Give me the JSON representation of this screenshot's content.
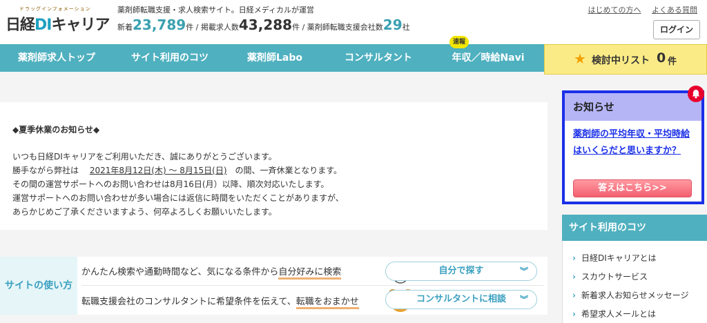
{
  "header": {
    "logo_small": "ドラッグインフォメーション",
    "logo_prefix": "日経",
    "logo_di": "DI",
    "logo_suffix": "キャリア",
    "tagline": "薬剤師転職支援・求人検索サイト。日経メディカルが運営",
    "stats": {
      "new_label": "新着",
      "new_count": "23,789",
      "unit1": "件 / 掲載求人数",
      "listed_count": "43,288",
      "unit2": "件 / 薬剤師転職支援会社数",
      "agencies_count": "29",
      "unit3": "社"
    },
    "links": [
      "はじめての方へ",
      "よくある質問"
    ],
    "login_label": "ログイン"
  },
  "nav": {
    "items": [
      "薬剤師求人トップ",
      "サイト利用のコツ",
      "薬剤師Labo",
      "コンサルタント",
      "年収／時給Navi"
    ],
    "badge": "速報",
    "watchlist_label": "検討中リスト",
    "watchlist_count": "0",
    "watchlist_unit": "件"
  },
  "notice": {
    "title": "◆夏季休業のお知らせ◆",
    "line1": "いつも日経DIキャリアをご利用いただき、誠にありがとうございます。",
    "line2_pre": "勝手ながら弊社は　 ",
    "line2_date": "2021年8月12日(木) ～ 8月15日(日)",
    "line2_post": "　の間、一斉休業となります。",
    "line3": "その間の運営サポートへのお問い合わせは8月16日(月）以降、順次対応いたします。",
    "line4": "運営サポートへのお問い合わせが多い場合には返信に時間をいただくことがありますが、",
    "line5": "あらかじめご了承くださいますよう、何卒よろしくお願いいたします。"
  },
  "usage": {
    "label": "サイトの使い方",
    "row1_pre": "かんたん検索や通勤時間など、気になる条件から",
    "row1_hl": "自分好みに検索",
    "row1_btn": "自分で探す",
    "row2_pre": "転職支援会社のコンサルタントに希望条件を伝えて、",
    "row2_hl": "転職をおまかせ",
    "row2_btn": "コンサルタントに相談"
  },
  "oshirase": {
    "title": "お知らせ",
    "link": "薬剤師の平均年収・平均時給はいくらだと思いますか？",
    "button": "答えはこちら>>"
  },
  "tips": {
    "title": "サイト利用のコツ",
    "items": [
      "日経DIキャリアとは",
      "スカウトサービス",
      "新着求人お知らせメッセージ",
      "希望求人メールとは"
    ]
  },
  "colors": {
    "nav": "#4fb0bf",
    "watchlist": "#fbeb86",
    "oshirase_border": "#1a2fe8",
    "oshirase_head": "#b5b5f6",
    "answer_button": "#f46070"
  }
}
